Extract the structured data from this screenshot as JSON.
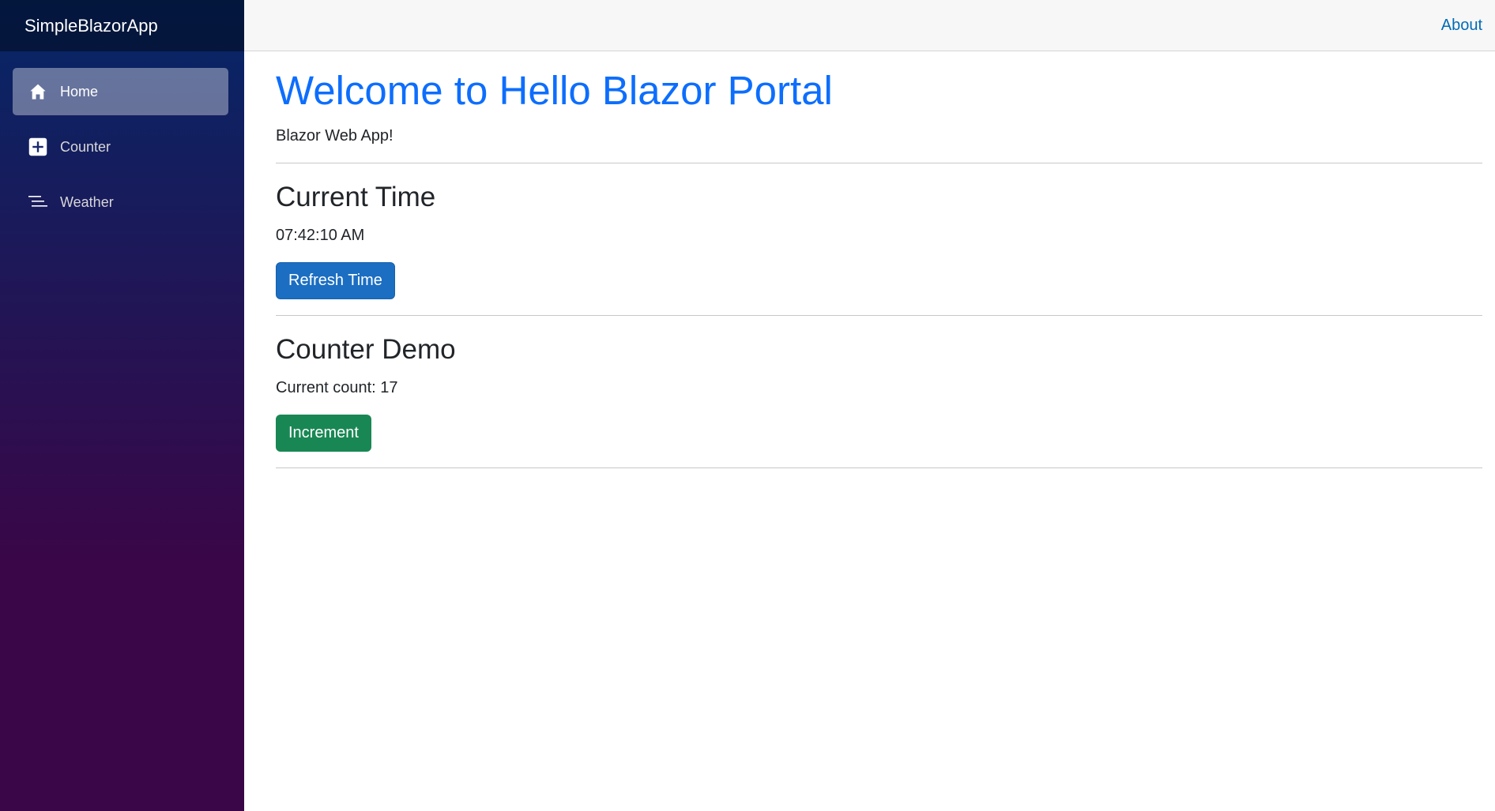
{
  "sidebar": {
    "brand": "SimpleBlazorApp",
    "items": [
      {
        "label": "Home",
        "icon": "home-icon",
        "active": true
      },
      {
        "label": "Counter",
        "icon": "plus-square-icon",
        "active": false
      },
      {
        "label": "Weather",
        "icon": "list-icon",
        "active": false
      }
    ]
  },
  "header": {
    "about_label": "About"
  },
  "main": {
    "title": "Welcome to Hello Blazor Portal",
    "subtitle": "Blazor Web App!",
    "time_section": {
      "heading": "Current Time",
      "time_value": "07:42:10 AM",
      "button_label": "Refresh Time"
    },
    "counter_section": {
      "heading": "Counter Demo",
      "count_text": "Current count: 17",
      "button_label": "Increment"
    }
  },
  "colors": {
    "sidebar_top": "#052767",
    "sidebar_bottom": "#3a0647",
    "title_blue": "#0d6efd",
    "primary_button": "#1b6ec2",
    "success_button": "#198754",
    "link": "#006bb7"
  }
}
